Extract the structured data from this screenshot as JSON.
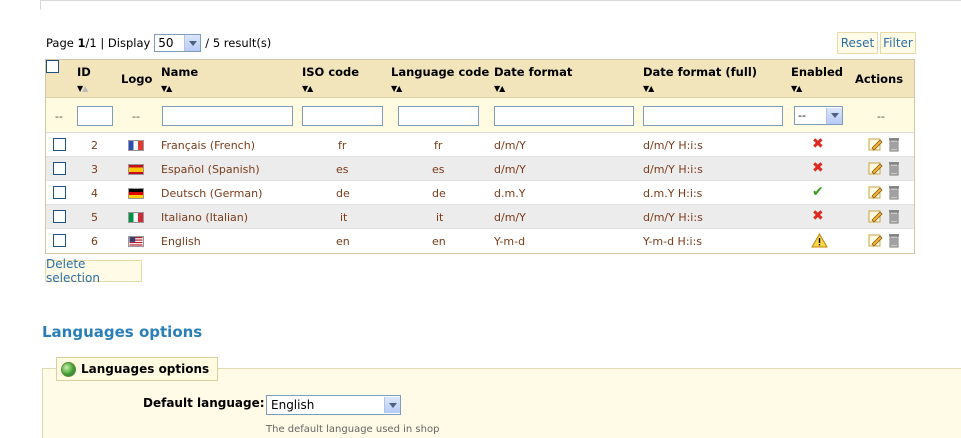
{
  "pagination": {
    "page_word": "Page",
    "page_current": "1",
    "page_sep": " / ",
    "page_total": "1",
    "display_label": "| Display",
    "display_value": "50",
    "results": "/ 5 result(s)"
  },
  "toolbar": {
    "reset_label": "Reset",
    "filter_label": "Filter",
    "delete_selection_label": "Delete selection"
  },
  "table": {
    "headers": {
      "id": "ID",
      "logo": "Logo",
      "name": "Name",
      "iso_code": "ISO code",
      "language_code": "Language code",
      "date_format": "Date format",
      "date_format_full": "Date format (full)",
      "enabled": "Enabled",
      "actions": "Actions"
    },
    "filter": {
      "dash": "--",
      "enabled_value": "--"
    },
    "rows": [
      {
        "id": "2",
        "name": "Français (French)",
        "iso": "fr",
        "lang": "fr",
        "date": "d/m/Y",
        "date_full": "d/m/Y H:i:s",
        "enabled": "no",
        "flag": "france-flag"
      },
      {
        "id": "3",
        "name": "Español (Spanish)",
        "iso": "es",
        "lang": "es",
        "date": "d/m/Y",
        "date_full": "d/m/Y H:i:s",
        "enabled": "no",
        "flag": "spain-flag"
      },
      {
        "id": "4",
        "name": "Deutsch (German)",
        "iso": "de",
        "lang": "de",
        "date": "d.m.Y",
        "date_full": "d.m.Y H:i:s",
        "enabled": "yes",
        "flag": "germany-flag"
      },
      {
        "id": "5",
        "name": "Italiano (Italian)",
        "iso": "it",
        "lang": "it",
        "date": "d/m/Y",
        "date_full": "d/m/Y H:i:s",
        "enabled": "no",
        "flag": "italy-flag"
      },
      {
        "id": "6",
        "name": "English",
        "iso": "en",
        "lang": "en",
        "date": "Y-m-d",
        "date_full": "Y-m-d H:i:s",
        "enabled": "warning",
        "flag": "usa-flag"
      }
    ]
  },
  "options": {
    "section_title": "Languages options",
    "legend": "Languages options",
    "default_language_label": "Default language:",
    "default_language_value": "English",
    "default_language_hint": "The default language used in shop"
  },
  "colors": {
    "header_bg": "#f2e5bc",
    "link": "#2a6fa8",
    "section_title": "#2a7fb8",
    "row_text": "#7a3b1a",
    "disabled": "#e0281f",
    "enabled": "#3a9a22"
  }
}
